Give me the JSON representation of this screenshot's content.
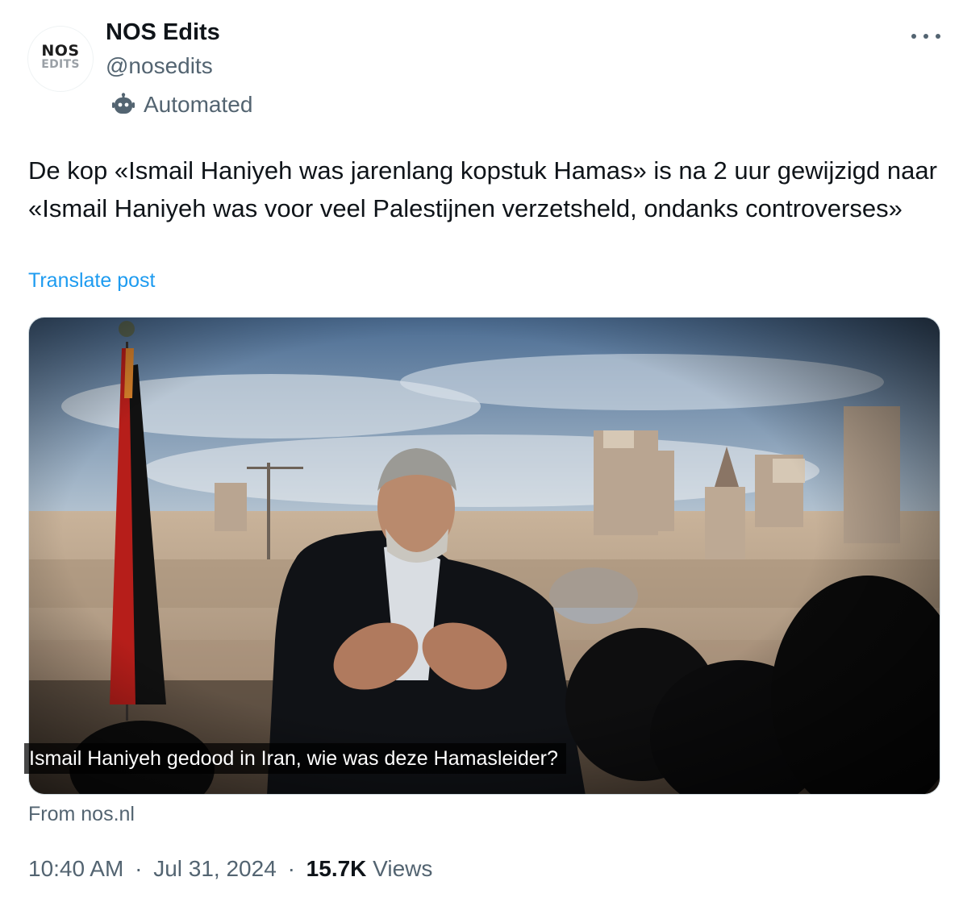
{
  "account": {
    "avatar_line1": "NOS",
    "avatar_line2": "EDITS",
    "display_name": "NOS Edits",
    "handle": "@nosedits",
    "automated_icon": "bot-icon",
    "automated_label": "Automated"
  },
  "post": {
    "text": "De kop «Ismail Haniyeh was jarenlang kopstuk Hamas» is na 2 uur gewijzigd naar «Ismail Haniyeh was voor veel Palestijnen verzetsheld, ondanks controverses»",
    "translate_label": "Translate post",
    "card": {
      "caption": "Ismail Haniyeh gedood in Iran, wie was deze Hamasleider?",
      "source": "From nos.nl"
    },
    "meta": {
      "time": "10:40 AM",
      "separator": "·",
      "date": "Jul 31, 2024",
      "views_count": "15.7K",
      "views_label": "Views"
    }
  },
  "colors": {
    "primary_text": "#0f1419",
    "secondary_text": "#536471",
    "link": "#1d9bf0"
  }
}
